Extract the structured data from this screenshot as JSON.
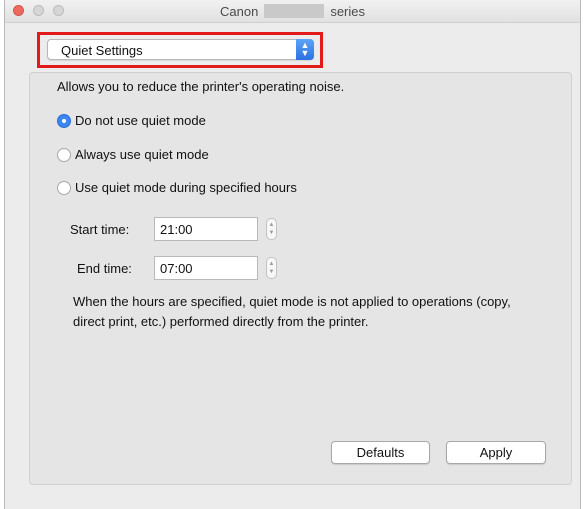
{
  "window": {
    "title_left": "Canon",
    "title_right": "series"
  },
  "select": {
    "value": "Quiet Settings"
  },
  "description": "Allows you to reduce the printer's operating noise.",
  "options": [
    {
      "label": "Do not use quiet mode",
      "selected": true
    },
    {
      "label": "Always use quiet mode",
      "selected": false
    },
    {
      "label": "Use quiet mode during specified hours",
      "selected": false
    }
  ],
  "start": {
    "label": "Start time:",
    "value": "21:00"
  },
  "end": {
    "label": "End time:",
    "value": "07:00"
  },
  "note": "When the hours are specified, quiet mode is not applied to operations (copy, direct print, etc.) performed directly from the printer.",
  "buttons": {
    "defaults": "Defaults",
    "apply": "Apply"
  },
  "colors": {
    "accent": "#3b86f0",
    "highlight": "#e21a1a"
  }
}
